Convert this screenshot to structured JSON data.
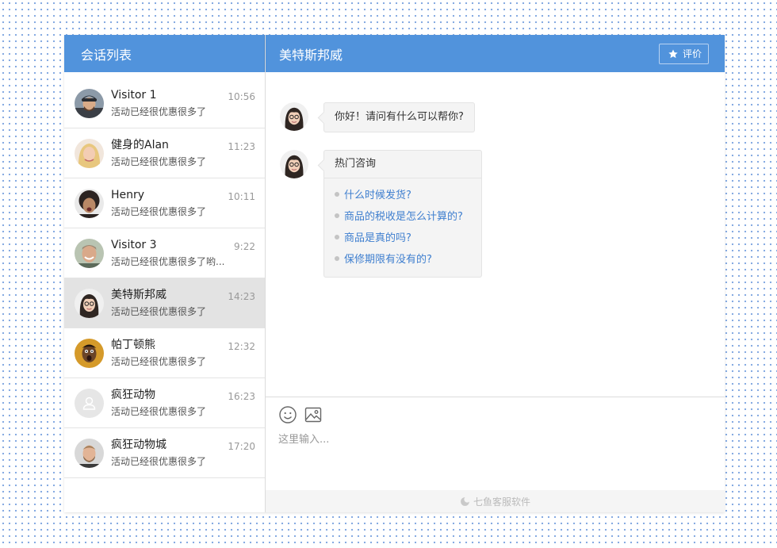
{
  "sidebar": {
    "title": "会话列表",
    "conversations": [
      {
        "name": "Visitor 1",
        "preview": "活动已经很优惠很多了",
        "time": "10:56",
        "avatar": "avatar-man-beanie"
      },
      {
        "name": "健身的Alan",
        "preview": "活动已经很优惠很多了",
        "time": "11:23",
        "avatar": "avatar-woman-blonde"
      },
      {
        "name": "Henry",
        "preview": "活动已经很优惠很多了",
        "time": "10:11",
        "avatar": "avatar-woman-curly"
      },
      {
        "name": "Visitor 3",
        "preview": "活动已经很优惠很多了哟...",
        "time": "9:22",
        "avatar": "avatar-man-smiling"
      },
      {
        "name": "美特斯邦威",
        "preview": "活动已经很优惠很多了",
        "time": "14:23",
        "avatar": "avatar-woman-glasses",
        "active": true
      },
      {
        "name": "帕丁顿熊",
        "preview": "活动已经很优惠很多了",
        "time": "12:32",
        "avatar": "avatar-man-surprised"
      },
      {
        "name": "疯狂动物",
        "preview": "活动已经很优惠很多了",
        "time": "16:23",
        "avatar": "avatar-placeholder"
      },
      {
        "name": "疯狂动物城",
        "preview": "活动已经很优惠很多了",
        "time": "17:20",
        "avatar": "avatar-man-beard"
      }
    ]
  },
  "chat": {
    "title": "美特斯邦威",
    "rate_label": "评价",
    "greeting": "你好！请问有什么可以帮你?",
    "hot_title": "热门咨询",
    "hot_questions": [
      "什么时候发货?",
      "商品的税收是怎么计算的?",
      "商品是真的吗?",
      "保修期限有没有的?"
    ]
  },
  "composer": {
    "placeholder": "这里输入...",
    "icons": [
      "emoji-icon",
      "image-icon"
    ]
  },
  "footer": {
    "brand": "七鱼客服软件"
  },
  "colors": {
    "header": "#5193dc",
    "link": "#3f7fcf",
    "active_row": "#e3e3e3"
  }
}
